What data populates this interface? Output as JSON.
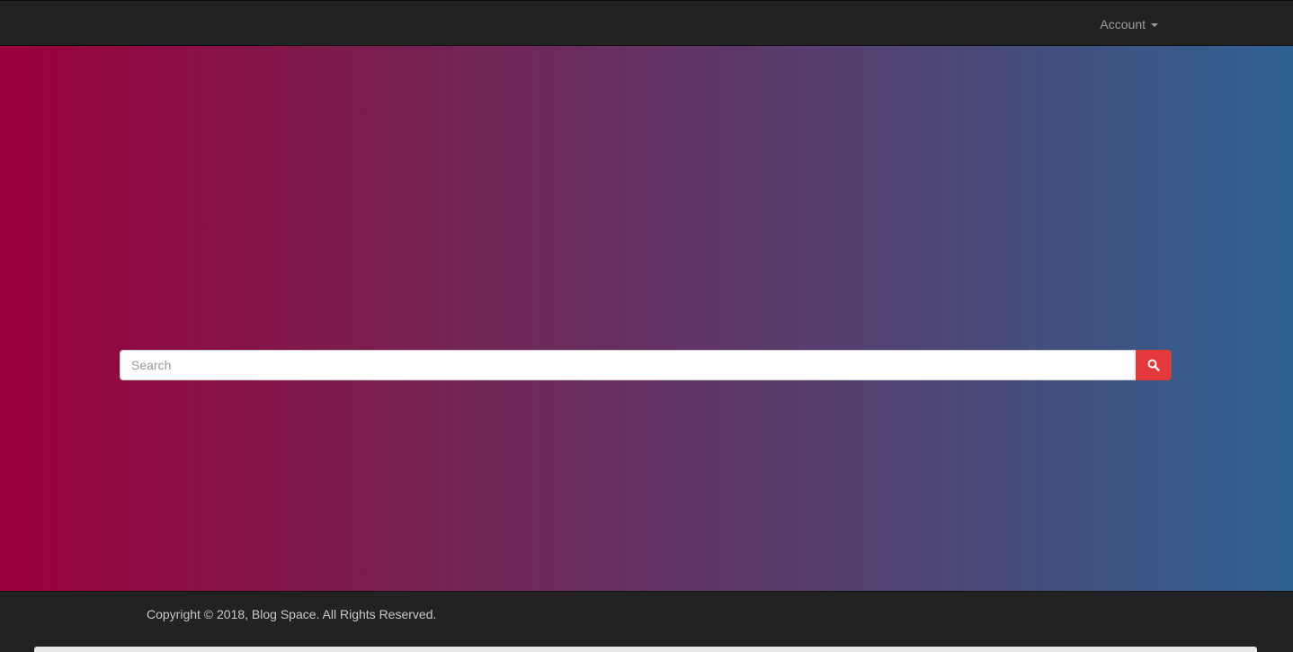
{
  "navbar": {
    "account_label": "Account"
  },
  "search": {
    "placeholder": "Search",
    "button_icon": "search-icon"
  },
  "footer": {
    "copyright": "Copyright © 2018, Blog Space. All Rights Reserved."
  },
  "colors": {
    "navbar_bg": "#222222",
    "gradient_start": "#9b003c",
    "gradient_end": "#2f6292",
    "search_button": "#e5383b"
  }
}
